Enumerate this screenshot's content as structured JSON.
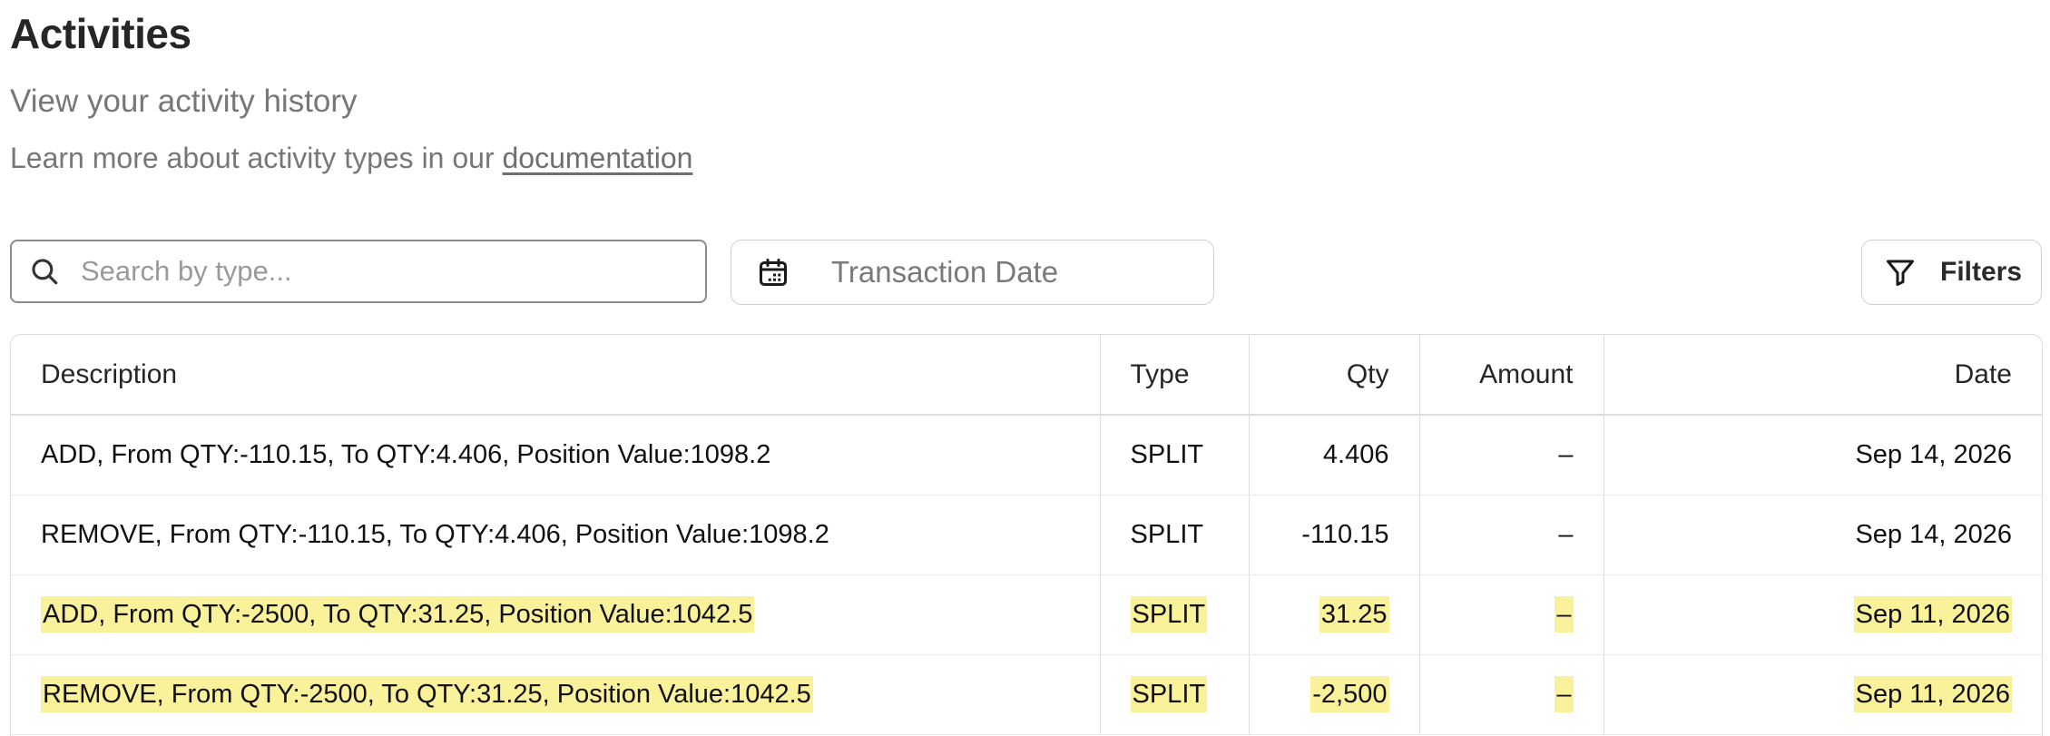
{
  "header": {
    "title": "Activities",
    "subtitle": "View your activity history",
    "learn_more_prefix": "Learn more about activity types in our ",
    "learn_more_link": "documentation"
  },
  "toolbar": {
    "search_placeholder": "Search by type...",
    "date_label": "Transaction Date",
    "filters_label": "Filters"
  },
  "icons": {
    "search": "search-icon",
    "calendar": "calendar-icon",
    "filter": "filter-icon"
  },
  "colors": {
    "highlight": "#faf29a"
  },
  "table": {
    "columns": [
      "Description",
      "Type",
      "Qty",
      "Amount",
      "Date"
    ],
    "rows": [
      {
        "description": "ADD, From QTY:-110.15, To QTY:4.406, Position Value:1098.2",
        "type": "SPLIT",
        "qty": "4.406",
        "amount": "–",
        "date": "Sep 14, 2026",
        "highlighted": false
      },
      {
        "description": "REMOVE, From QTY:-110.15, To QTY:4.406, Position Value:1098.2",
        "type": "SPLIT",
        "qty": "-110.15",
        "amount": "–",
        "date": "Sep 14, 2026",
        "highlighted": false
      },
      {
        "description": "ADD, From QTY:-2500, To QTY:31.25, Position Value:1042.5",
        "type": "SPLIT",
        "qty": "31.25",
        "amount": "–",
        "date": "Sep 11, 2026",
        "highlighted": true
      },
      {
        "description": "REMOVE, From QTY:-2500, To QTY:31.25, Position Value:1042.5",
        "type": "SPLIT",
        "qty": "-2,500",
        "amount": "–",
        "date": "Sep 11, 2026",
        "highlighted": true
      }
    ]
  }
}
